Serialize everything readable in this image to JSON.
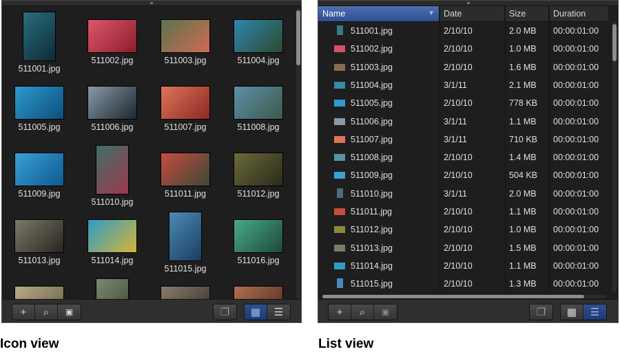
{
  "icon_view": {
    "caption": "Icon view",
    "thumbnails": [
      {
        "label": "511001.jpg",
        "shape": "portrait",
        "colors": [
          "#2a6e7c",
          "#0e2b36"
        ]
      },
      {
        "label": "511002.jpg",
        "shape": "landscape",
        "colors": [
          "#e0546a",
          "#8a1e2c"
        ]
      },
      {
        "label": "511003.jpg",
        "shape": "landscape",
        "colors": [
          "#5a7450",
          "#d06a50"
        ]
      },
      {
        "label": "511004.jpg",
        "shape": "landscape",
        "colors": [
          "#2f86b0",
          "#2c4a2e"
        ]
      },
      {
        "label": "511005.jpg",
        "shape": "landscape",
        "colors": [
          "#2f9ad0",
          "#0b4f7a"
        ]
      },
      {
        "label": "511006.jpg",
        "shape": "landscape",
        "colors": [
          "#8a9aa6",
          "#1b2630"
        ]
      },
      {
        "label": "511007.jpg",
        "shape": "landscape",
        "colors": [
          "#e07458",
          "#8a2a24"
        ]
      },
      {
        "label": "511008.jpg",
        "shape": "landscape",
        "colors": [
          "#5d8fa8",
          "#3d5a4a"
        ]
      },
      {
        "label": "511009.jpg",
        "shape": "landscape",
        "colors": [
          "#3aa0d8",
          "#0f5a8e"
        ]
      },
      {
        "label": "511010.jpg",
        "shape": "portrait",
        "colors": [
          "#406e6a",
          "#9a3a4a"
        ]
      },
      {
        "label": "511011.jpg",
        "shape": "landscape",
        "colors": [
          "#c84a40",
          "#3c4a36"
        ]
      },
      {
        "label": "511012.jpg",
        "shape": "landscape",
        "colors": [
          "#6a6a3a",
          "#2b2a1a"
        ]
      },
      {
        "label": "511013.jpg",
        "shape": "landscape",
        "colors": [
          "#7a7a6a",
          "#2a2420"
        ]
      },
      {
        "label": "511014.jpg",
        "shape": "landscape",
        "colors": [
          "#2f9cc8",
          "#d4b438"
        ]
      },
      {
        "label": "511015.jpg",
        "shape": "portrait",
        "colors": [
          "#4a8ab8",
          "#1d3d5e"
        ]
      },
      {
        "label": "511016.jpg",
        "shape": "landscape",
        "colors": [
          "#4aa88a",
          "#1d4a3a"
        ]
      },
      {
        "label": "",
        "shape": "landscape",
        "colors": [
          "#b8aa88",
          "#6a6048"
        ]
      },
      {
        "label": "",
        "shape": "portrait",
        "colors": [
          "#7a8a70",
          "#3a4030"
        ]
      },
      {
        "label": "",
        "shape": "landscape",
        "colors": [
          "#8a7a6a",
          "#3a3028"
        ]
      },
      {
        "label": "",
        "shape": "landscape",
        "colors": [
          "#b07050",
          "#4a2a20"
        ]
      }
    ],
    "toolbar": {
      "add_icon": "+",
      "search_icon": "⌕",
      "import_icon": "▣",
      "stack_icon": "❐",
      "grid_icon": "▦",
      "list_icon": "☰"
    }
  },
  "list_view": {
    "caption": "List view",
    "columns": [
      "Name",
      "Date",
      "Size",
      "Duration"
    ],
    "sort_indicator": "▼",
    "rows": [
      {
        "name": "511001.jpg",
        "date": "2/10/10",
        "size": "2.0 MB",
        "duration": "00:00:01:00",
        "thumb": "portrait",
        "color": "#3a7a8c"
      },
      {
        "name": "511002.jpg",
        "date": "2/10/10",
        "size": "1.0 MB",
        "duration": "00:00:01:00",
        "thumb": "landscape",
        "color": "#d8506a"
      },
      {
        "name": "511003.jpg",
        "date": "2/10/10",
        "size": "1.6 MB",
        "duration": "00:00:01:00",
        "thumb": "landscape",
        "color": "#8a6a4a"
      },
      {
        "name": "511004.jpg",
        "date": "3/1/11",
        "size": "2.1 MB",
        "duration": "00:00:01:00",
        "thumb": "landscape",
        "color": "#3a8aaa"
      },
      {
        "name": "511005.jpg",
        "date": "2/10/10",
        "size": "778 KB",
        "duration": "00:00:01:00",
        "thumb": "landscape",
        "color": "#2f9ad0"
      },
      {
        "name": "511006.jpg",
        "date": "3/1/11",
        "size": "1.1 MB",
        "duration": "00:00:01:00",
        "thumb": "landscape",
        "color": "#8a9aa6"
      },
      {
        "name": "511007.jpg",
        "date": "3/1/11",
        "size": "710 KB",
        "duration": "00:00:01:00",
        "thumb": "landscape",
        "color": "#e07458"
      },
      {
        "name": "511008.jpg",
        "date": "2/10/10",
        "size": "1.4 MB",
        "duration": "00:00:01:00",
        "thumb": "landscape",
        "color": "#5d8fa8"
      },
      {
        "name": "511009.jpg",
        "date": "2/10/10",
        "size": "504 KB",
        "duration": "00:00:01:00",
        "thumb": "landscape",
        "color": "#3aa0d8"
      },
      {
        "name": "511010.jpg",
        "date": "3/1/11",
        "size": "2.0 MB",
        "duration": "00:00:01:00",
        "thumb": "portrait",
        "color": "#4a6e7a"
      },
      {
        "name": "511011.jpg",
        "date": "2/10/10",
        "size": "1.1 MB",
        "duration": "00:00:01:00",
        "thumb": "landscape",
        "color": "#c84a40"
      },
      {
        "name": "511012.jpg",
        "date": "2/10/10",
        "size": "1.0 MB",
        "duration": "00:00:01:00",
        "thumb": "landscape",
        "color": "#8a8a3a"
      },
      {
        "name": "511013.jpg",
        "date": "2/10/10",
        "size": "1.5 MB",
        "duration": "00:00:01:00",
        "thumb": "landscape",
        "color": "#7a7a6a"
      },
      {
        "name": "511014.jpg",
        "date": "2/10/10",
        "size": "1.1 MB",
        "duration": "00:00:01:00",
        "thumb": "landscape",
        "color": "#2f9cc8"
      },
      {
        "name": "511015.jpg",
        "date": "2/10/10",
        "size": "1.3 MB",
        "duration": "00:00:01:00",
        "thumb": "portrait",
        "color": "#4a8ab8"
      }
    ],
    "toolbar": {
      "add_icon": "+",
      "search_icon": "⌕",
      "import_icon": "▣",
      "stack_icon": "❐",
      "grid_icon": "▦",
      "list_icon": "☰"
    }
  }
}
